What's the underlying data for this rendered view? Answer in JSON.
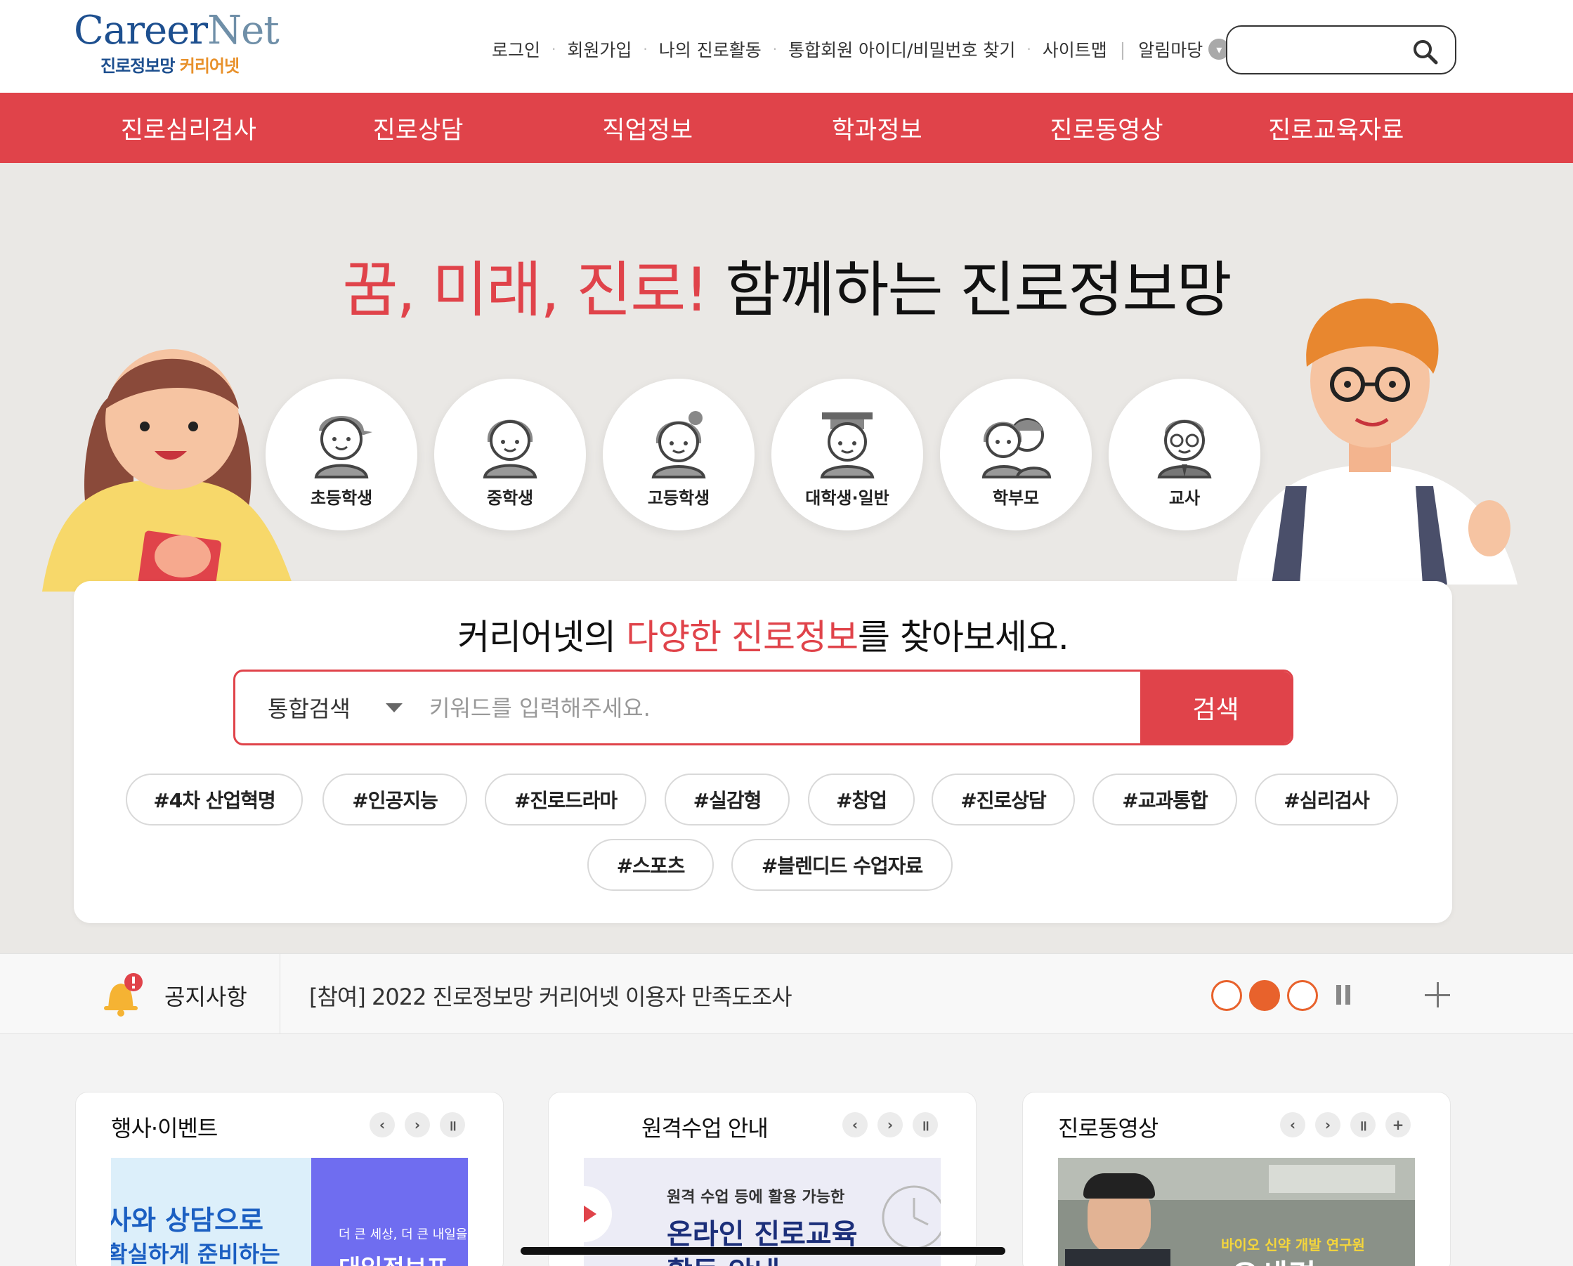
{
  "logo": {
    "main_a": "Career",
    "main_b": "Net",
    "sub_a": "진로정보망 ",
    "sub_b": "커리어넷"
  },
  "util_nav": [
    "로그인",
    "회원가입",
    "나의 진로활동",
    "통합회원 아이디/비밀번호 찾기",
    "사이트맵",
    "알림마당"
  ],
  "gnb": [
    "진로심리검사",
    "진로상담",
    "직업정보",
    "학과정보",
    "진로동영상",
    "진로교육자료"
  ],
  "hero": {
    "title_red": "꿈, 미래, 진로!",
    "title_black": " 함께하는 진로정보망"
  },
  "user_types": [
    {
      "label": "초등학생",
      "icon": "elementary-student-icon"
    },
    {
      "label": "중학생",
      "icon": "middle-school-student-icon"
    },
    {
      "label": "고등학생",
      "icon": "high-school-student-icon"
    },
    {
      "label": "대학생·일반",
      "icon": "university-student-icon"
    },
    {
      "label": "학부모",
      "icon": "parents-icon"
    },
    {
      "label": "교사",
      "icon": "teacher-icon"
    }
  ],
  "search": {
    "title_a": "커리어넷의 ",
    "title_red": "다양한 진로정보",
    "title_b": "를 찾아보세요.",
    "select_value": "통합검색",
    "placeholder": "키워드를 입력해주세요.",
    "button": "검색"
  },
  "tags": [
    "#4차 산업혁명",
    "#인공지능",
    "#진로드라마",
    "#실감형",
    "#창업",
    "#진로상담",
    "#교과통합",
    "#심리검사",
    "#스포츠",
    "#블렌디드 수업자료"
  ],
  "notice": {
    "label": "공지사항",
    "text": "[참여] 2022 진로정보망 커리어넷 이용자 만족도조사"
  },
  "panels": [
    {
      "title": "행사·이벤트",
      "thumb_a": "사와 상담으로",
      "thumb_b": "확실하게 준비하는",
      "thumb_c": "더 큰 세상, 더 큰 내일을",
      "thumb_d": "대입정보포"
    },
    {
      "title": "원격수업 안내",
      "thumb_a": "원격 수업 등에 활용 가능한",
      "thumb_b": "온라인 진로교육",
      "thumb_c": "활동 안내"
    },
    {
      "title": "진로동영상",
      "thumb_a": "바이오 신약 개발 연구원",
      "thumb_b": "오세경"
    }
  ],
  "colors": {
    "brand_red": "#e0434a",
    "notice_orange": "#e8622c",
    "hero_bg": "#eae8e5"
  }
}
